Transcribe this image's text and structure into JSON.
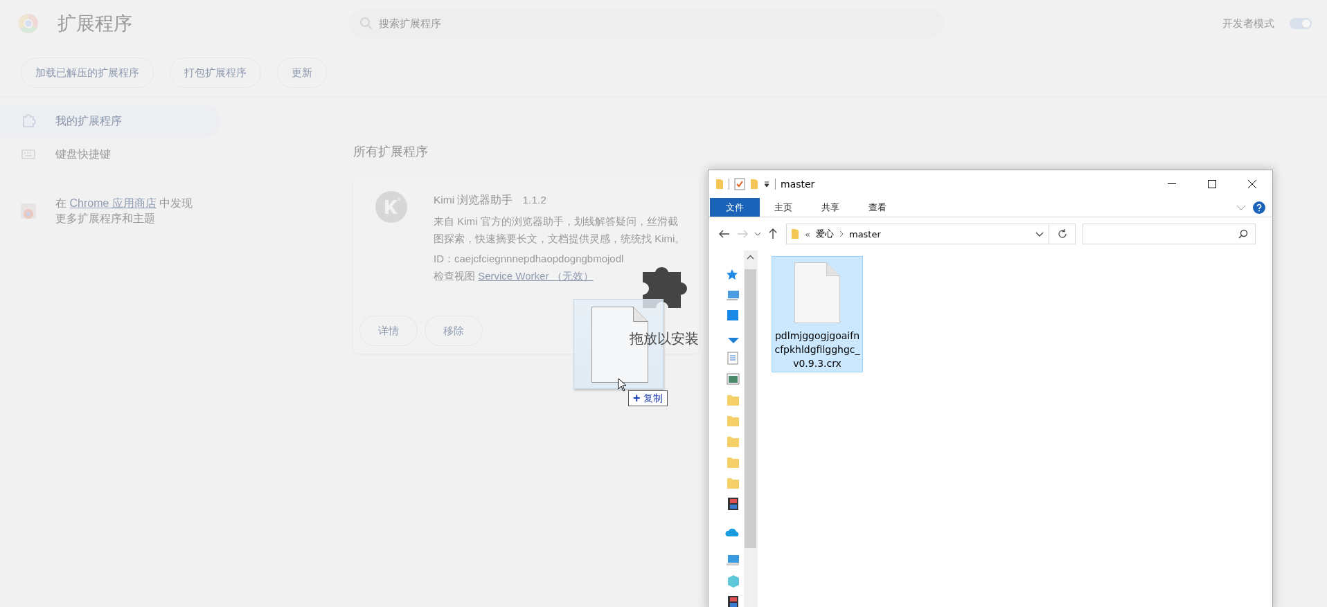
{
  "extensions_page": {
    "title": "扩展程序",
    "search": {
      "placeholder": "搜索扩展程序"
    },
    "developer_mode": {
      "label": "开发者模式",
      "on": true
    },
    "toolbar_buttons": [
      "加载已解压的扩展程序",
      "打包扩展程序",
      "更新"
    ],
    "sidebar": {
      "items": [
        {
          "label": "我的扩展程序",
          "selected": true
        },
        {
          "label": "键盘快捷键",
          "selected": false
        }
      ],
      "store_promo": {
        "before": "在 ",
        "link": "Chrome 应用商店",
        "after": " 中发现",
        "line_2": "更多扩展程序和主题"
      }
    },
    "section_title": "所有扩展程序",
    "extensions": [
      {
        "name": "Kimi 浏览器助手",
        "version": "1.1.2",
        "description": "来自 Kimi 官方的浏览器助手，划线解答疑问，丝滑截图探索，快速摘要长文，文档提供灵感，统统找 Kimi。",
        "id": "ID：caejcfciegnnnepdhaopdogngbmojodl",
        "inspect_label": "检查视图",
        "inspect_link": "Service Worker （无效）",
        "buttons": [
          "详情",
          "移除"
        ]
      }
    ]
  },
  "drag": {
    "label": "拖放以安装",
    "effect_mark": "+",
    "effect": "复制"
  },
  "explorer": {
    "title": "master",
    "ribbon_tabs": [
      {
        "label": "文件",
        "selected": true
      },
      {
        "label": "主页",
        "selected": false
      },
      {
        "label": "共享",
        "selected": false
      },
      {
        "label": "查看",
        "selected": false
      }
    ],
    "path_overflow": "«",
    "path": [
      "爱心",
      "master"
    ],
    "files": [
      {
        "name": "pdlmjggogjgoaifncfpkhldgfilgghgc_v0.9.3.crx",
        "selected": true
      }
    ]
  }
}
